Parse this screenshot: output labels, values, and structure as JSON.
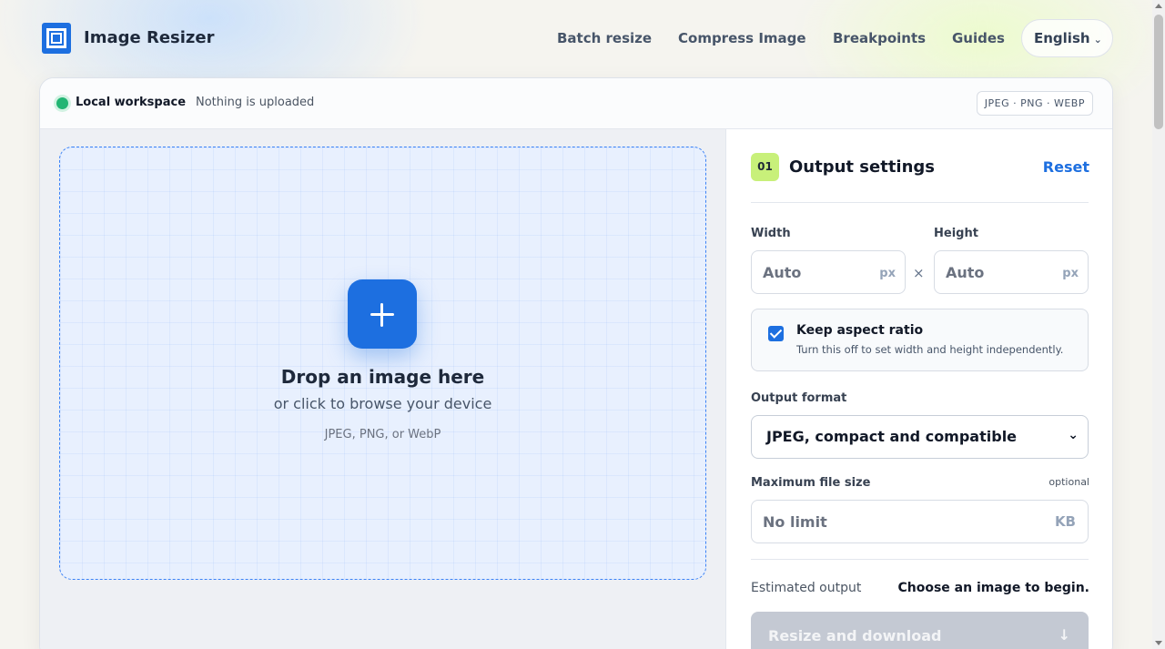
{
  "header": {
    "brand": "Image Resizer",
    "nav": [
      "Batch resize",
      "Compress Image",
      "Breakpoints",
      "Guides"
    ],
    "language": "English",
    "language_icon": "chevron-down-icon"
  },
  "workspace": {
    "label": "Local workspace",
    "status": "Nothing is uploaded",
    "formats": "JPEG · PNG · WEBP",
    "status_color": "#22b573"
  },
  "dropzone": {
    "title": "Drop an image here",
    "subtitle": "or click to browse your device",
    "hint": "JPEG, PNG, or WebP",
    "icon": "plus-icon"
  },
  "settings": {
    "step": "01",
    "title": "Output settings",
    "reset": "Reset",
    "width": {
      "label": "Width",
      "placeholder": "Auto",
      "unit": "px"
    },
    "height": {
      "label": "Height",
      "placeholder": "Auto",
      "unit": "px"
    },
    "separator": "×",
    "aspect": {
      "title": "Keep aspect ratio",
      "description": "Turn this off to set width and height independently.",
      "checked": true
    },
    "format": {
      "label": "Output format",
      "selected": "JPEG, compact and compatible"
    },
    "max_size": {
      "label": "Maximum file size",
      "optional": "optional",
      "placeholder": "No limit",
      "unit": "KB"
    },
    "estimate": {
      "label": "Estimated output",
      "value": "Choose an image to begin."
    },
    "download": {
      "label": "Resize and download",
      "icon": "↓"
    }
  },
  "colors": {
    "accent": "#1d6fe0",
    "step_badge": "#c8f07a",
    "disabled_button": "#c4c9d3"
  }
}
